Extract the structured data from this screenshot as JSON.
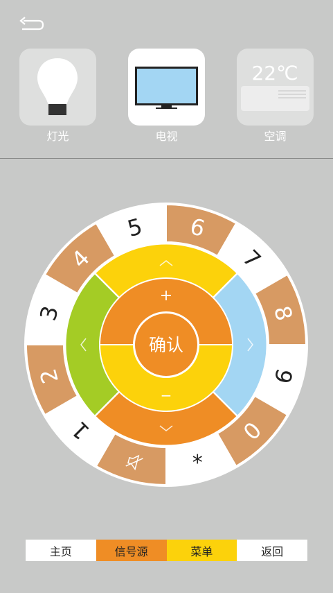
{
  "header": {
    "back_icon": "back-arrow-icon"
  },
  "devices": [
    {
      "label": "灯光",
      "icon": "light-bulb-icon",
      "active": false
    },
    {
      "label": "电视",
      "icon": "tv-icon",
      "active": true
    },
    {
      "label": "空调",
      "icon": "air-conditioner-icon",
      "active": false,
      "temperature": "22℃"
    }
  ],
  "remote": {
    "ok_label": "确认",
    "plus_label": "+",
    "minus_label": "−",
    "up_icon": "chevron-up-icon",
    "down_icon": "chevron-down-icon",
    "left_icon": "chevron-left-icon",
    "right_icon": "chevron-right-icon",
    "mute_icon": "mute-icon",
    "star_label": "*",
    "keys": [
      "1",
      "2",
      "3",
      "4",
      "5",
      "6",
      "7",
      "8",
      "9",
      "0"
    ]
  },
  "bottom_bar": {
    "home": "主页",
    "source": "信号源",
    "menu": "菜单",
    "back": "返回"
  },
  "colors": {
    "background": "#c8c9c8",
    "orange": "#ef8d25",
    "yellow": "#fcd20b",
    "green": "#a4cc25",
    "blue": "#a3d6f3",
    "key_tan": "#d79a63",
    "white": "#ffffff"
  }
}
